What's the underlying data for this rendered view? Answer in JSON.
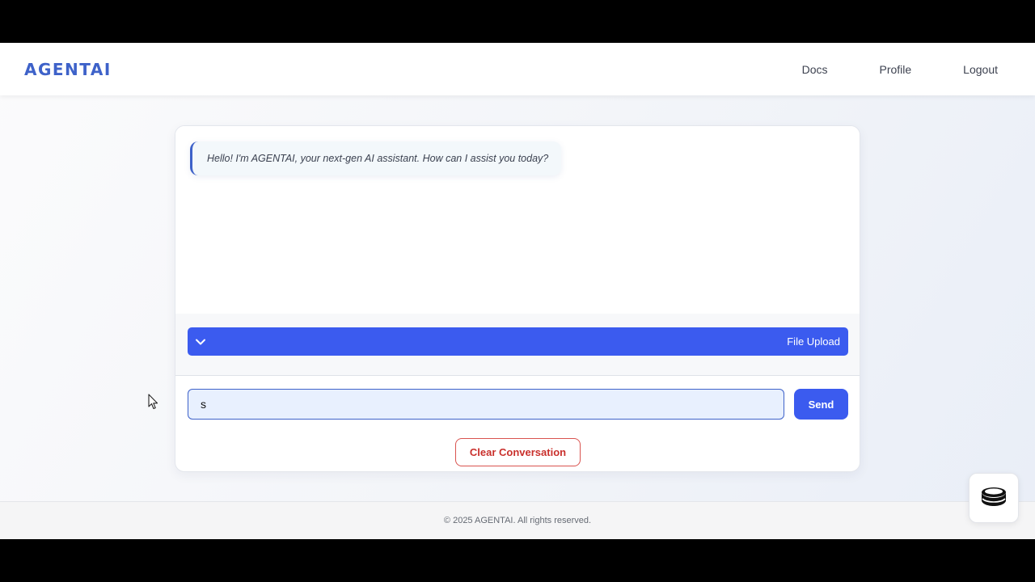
{
  "brand": {
    "logo": "AGENTAI"
  },
  "nav": {
    "items": [
      {
        "label": "Docs"
      },
      {
        "label": "Profile"
      },
      {
        "label": "Logout"
      }
    ]
  },
  "chat": {
    "messages": [
      {
        "role": "bot",
        "text": "Hello! I'm AGENTAI, your next-gen AI assistant. How can I assist you today?"
      }
    ],
    "file_upload": {
      "label": "File Upload",
      "icon": "chevron-down-icon"
    },
    "input": {
      "value": "s"
    },
    "send_label": "Send",
    "clear_label": "Clear Conversation"
  },
  "footer": {
    "text": "© 2025 AGENTAI. All rights reserved."
  },
  "floating": {
    "icon": "database-icon"
  },
  "colors": {
    "accent": "#3b5bef",
    "brand": "#3e62c9",
    "danger": "#c9302c"
  }
}
